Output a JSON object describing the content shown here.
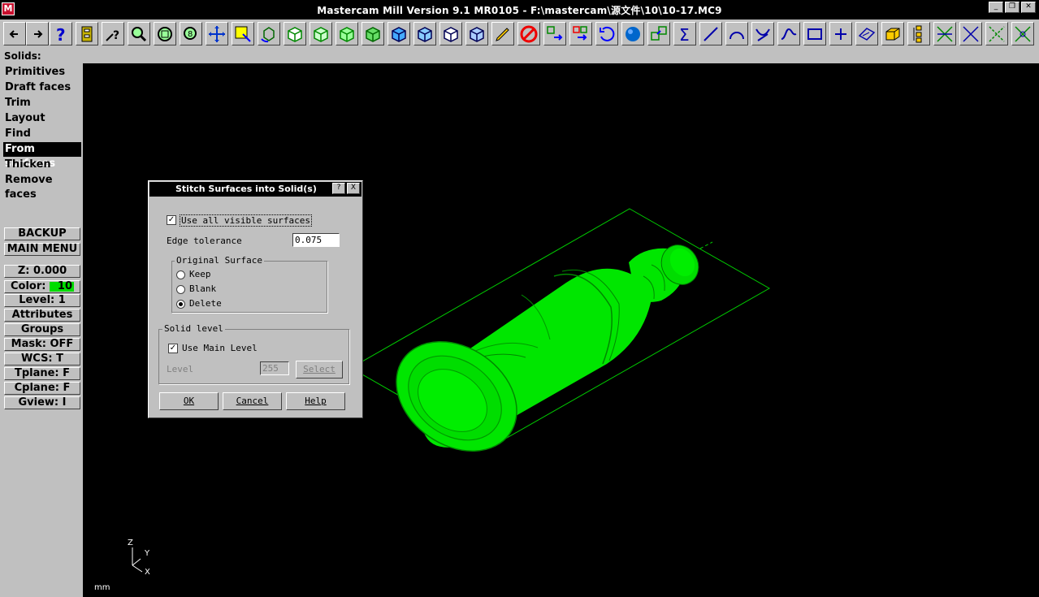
{
  "window": {
    "title": "Mastercam Mill Version 9.1 MR0105 - F:\\mastercam\\源文件\\10\\10-17.MC9",
    "icon_text": "M"
  },
  "toolbar": {
    "buttons": [
      "back-arrow-icon",
      "forward-arrow-icon",
      "help-icon",
      "file-cabinet-icon",
      "query-icon",
      "zoom-icon",
      "fit-icon",
      "zoom-window-icon",
      "pan-icon",
      "select-icon",
      "rotate-icon",
      "view-iso-1-icon",
      "view-iso-2-icon",
      "view-iso-3-icon",
      "view-iso-4-icon",
      "view-cube-1-icon",
      "view-cube-2-icon",
      "view-cube-3-icon",
      "view-cube-4-icon",
      "pencil-icon",
      "no-entry-icon",
      "transform-icon",
      "multi-transform-icon",
      "undo-icon",
      "sphere-icon",
      "copy-icon",
      "sigma-icon",
      "line-icon",
      "arc-icon",
      "trim-icon",
      "spline-icon",
      "rectangle-icon",
      "point-icon",
      "plane-icon",
      "solid-box-icon",
      "tree-icon",
      "break-icon",
      "divide-icon",
      "extend-icon",
      "fillet-icon"
    ]
  },
  "status": {
    "prompt": "Solids:"
  },
  "sidebar": {
    "menu": [
      {
        "label": "Primitives",
        "selected": false
      },
      {
        "label": "Draft faces",
        "selected": false
      },
      {
        "label": "Trim",
        "selected": false
      },
      {
        "label": "Layout",
        "selected": false
      },
      {
        "label": "Find features",
        "selected": false
      },
      {
        "label": "From surfaces",
        "selected": true
      },
      {
        "label": "Thicken",
        "selected": false
      },
      {
        "label": "Remove faces",
        "selected": false
      }
    ],
    "backup": "BACKUP",
    "main_menu": "MAIN MENU",
    "z": "Z:  0.000",
    "color_label": "Color:",
    "color_value": "10",
    "level": "Level:  1",
    "attributes": "Attributes",
    "groups": "Groups",
    "mask": "Mask:  OFF",
    "wcs": "WCS:   T",
    "tplane": "Tplane:  F",
    "cplane": "Cplane:  F",
    "gview": "Gview:   I"
  },
  "dialog": {
    "title": "Stitch Surfaces into Solid(s)",
    "use_all_visible": "Use all visible surfaces",
    "use_all_checked": true,
    "edge_tolerance_label": "Edge tolerance",
    "edge_tolerance_value": "0.075",
    "original_surface_label": "Original Surface",
    "radio_keep": "Keep",
    "radio_blank": "Blank",
    "radio_delete": "Delete",
    "radio_selected": "Delete",
    "solid_level_label": "Solid level",
    "use_main_level": "Use Main Level",
    "use_main_level_checked": true,
    "level_label": "Level",
    "level_value": "255",
    "select_label": "Select",
    "ok": "OK",
    "cancel": "Cancel",
    "help": "Help",
    "help_btn": "?",
    "close_btn": "X"
  },
  "viewport": {
    "units": "mm",
    "axis_z": "Z",
    "axis_y": "Y",
    "axis_x": "X",
    "model_color": "#00ee00"
  }
}
